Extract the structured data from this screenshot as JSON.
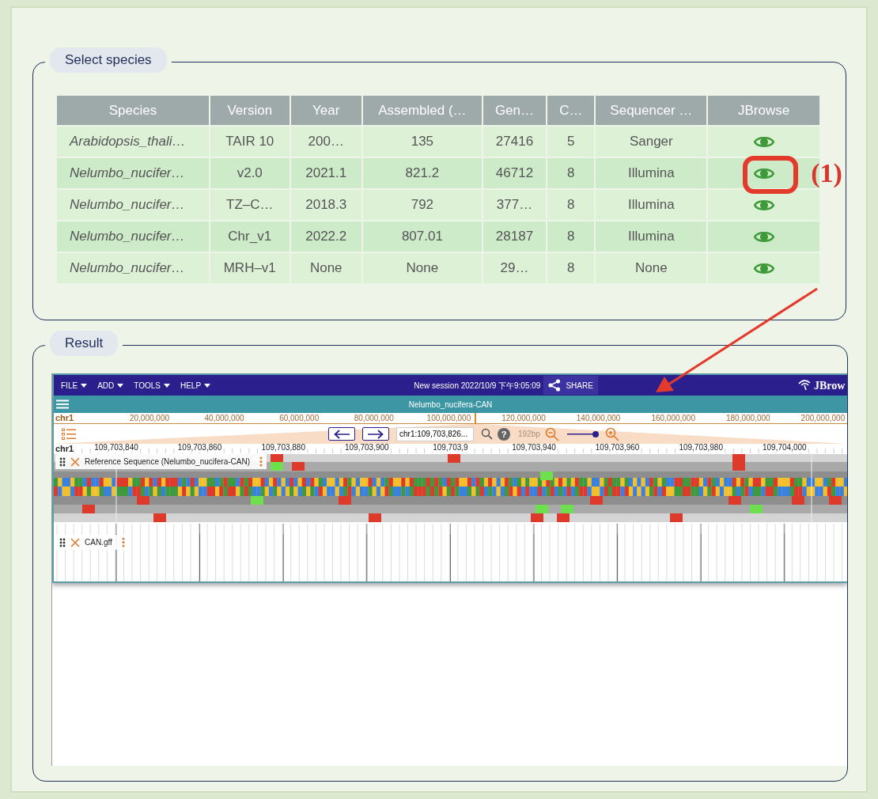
{
  "select_species": {
    "legend": "Select species",
    "table": {
      "columns": [
        "Species",
        "Version",
        "Year",
        "Assembled (…",
        "Gen…",
        "C…",
        "Sequencer …",
        "JBrowse"
      ],
      "rows": [
        {
          "cells": [
            "Arabidopsis_thali…",
            "TAIR 10",
            "200…",
            "135",
            "27416",
            "5",
            "Sanger"
          ],
          "highlighted": false
        },
        {
          "cells": [
            "Nelumbo_nucifer…",
            "v2.0",
            "2021.1",
            "821.2",
            "46712",
            "8",
            "Illumina"
          ],
          "highlighted": true
        },
        {
          "cells": [
            "Nelumbo_nucifer…",
            "TZ–C…",
            "2018.3",
            "792",
            "377…",
            "8",
            "Illumina"
          ],
          "highlighted": false
        },
        {
          "cells": [
            "Nelumbo_nucifer…",
            "Chr_v1",
            "2022.2",
            "807.01",
            "28187",
            "8",
            "Illumina"
          ],
          "highlighted": false
        },
        {
          "cells": [
            "Nelumbo_nucifer…",
            "MRH–v1",
            "None",
            "None",
            "29…",
            "8",
            "None"
          ],
          "highlighted": false
        }
      ]
    },
    "callout": "(1)"
  },
  "result": {
    "legend": "Result",
    "jbrowse": {
      "menu": [
        "FILE",
        "ADD",
        "TOOLS",
        "HELP"
      ],
      "session": "New session 2022/10/9 下午9:05:09",
      "share": "SHARE",
      "logo": "JBrow",
      "view_title": "Nelumbo_nucifera-CAN",
      "overview": {
        "chrom": "chr1",
        "ticks": [
          "20,000,000",
          "40,000,000",
          "60,000,000",
          "80,000,000",
          "100,000,000",
          "120,000,000",
          "140,000,000",
          "160,000,000",
          "180,000,000",
          "200,000,000"
        ]
      },
      "location": "chr1:109,703,826...",
      "help": "?",
      "span": "192bp",
      "zoom": {
        "level": 1
      },
      "detail": {
        "chrom": "chr1",
        "ticks": [
          "109,703,840",
          "109,703,860",
          "109,703,880",
          "109,703,900",
          "109,703,9",
          "109,703,940",
          "109,703,960",
          "109,703,980",
          "109,704,000"
        ]
      },
      "tracks": [
        {
          "name": "Reference Sequence (Nelumbo_nucifera-CAN)",
          "kind": "sequence"
        },
        {
          "name": "CAN.gff",
          "kind": "features"
        }
      ]
    }
  }
}
